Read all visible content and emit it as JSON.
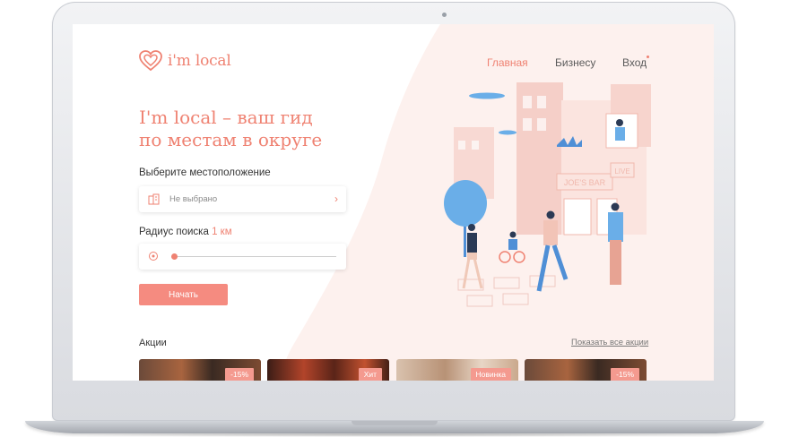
{
  "brand": {
    "name": "i'm local",
    "color": "#ef8272"
  },
  "nav": {
    "home": "Главная",
    "business": "Бизнесу",
    "login": "Вход"
  },
  "hero": {
    "title_line1": "I'm local – ваш гид",
    "title_line2": "по местам в округе"
  },
  "location": {
    "label": "Выберите местоположение",
    "value": "Не выбрано",
    "icon": "city-icon",
    "action_icon": "chevron-right-icon"
  },
  "radius": {
    "label": "Радиус поиска",
    "value": "1 км",
    "slider_level": 0
  },
  "start_button": "Начать",
  "promos": {
    "title": "Акции",
    "show_all": "Показать все акции",
    "cards": [
      {
        "badge": "-15%"
      },
      {
        "badge": "Хит"
      },
      {
        "badge": "Новинка"
      },
      {
        "badge": "-15%"
      }
    ]
  },
  "illustration": {
    "sign_text": "JOE'S BAR",
    "live_sign": "LIVE"
  }
}
